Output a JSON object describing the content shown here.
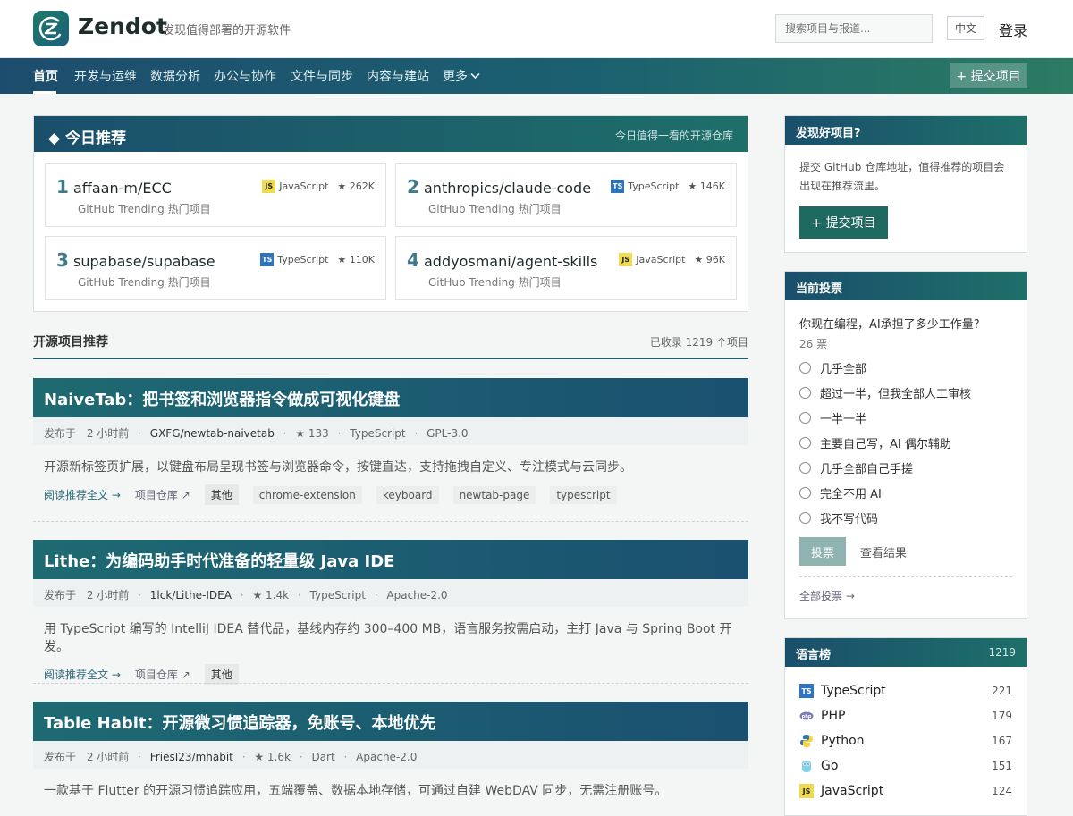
{
  "header": {
    "brand": "Zendot",
    "slogan": "发现值得部署的开源软件",
    "search_placeholder": "搜索项目与报道...",
    "lang_button": "中文",
    "login": "登录"
  },
  "nav": {
    "items": [
      "首页",
      "开发与运维",
      "数据分析",
      "办公与协作",
      "文件与同步",
      "内容与建站",
      "更多"
    ],
    "submit": "+ 提交项目"
  },
  "today": {
    "title": "◆ 今日推荐",
    "subtitle": "今日值得一看的开源仓库",
    "cards": [
      {
        "num": "1",
        "name": "affaan-m/ECC",
        "source": "GitHub Trending 热门项目",
        "lang": "JavaScript",
        "lang_badge": "JS",
        "stars": "★ 262K"
      },
      {
        "num": "2",
        "name": "anthropics/claude-code",
        "source": "GitHub Trending 热门项目",
        "lang": "TypeScript",
        "lang_badge": "TS",
        "stars": "★ 146K"
      },
      {
        "num": "3",
        "name": "supabase/supabase",
        "source": "GitHub Trending 热门项目",
        "lang": "TypeScript",
        "lang_badge": "TS",
        "stars": "★ 110K"
      },
      {
        "num": "4",
        "name": "addyosmani/agent-skills",
        "source": "GitHub Trending 热门项目",
        "lang": "JavaScript",
        "lang_badge": "JS",
        "stars": "★ 96K"
      }
    ]
  },
  "section": {
    "title": "开源项目推荐",
    "count": "已收录 1219 个项目"
  },
  "articles": [
    {
      "title": "NaiveTab：把书签和浏览器指令做成可视化键盘",
      "published_label": "发布于",
      "time": "2 小时前",
      "repo": "GXFG/newtab-naivetab",
      "stars": "★ 133",
      "lang": "TypeScript",
      "license": "GPL-3.0",
      "desc": "开源新标签页扩展，以键盘布局呈现书签与浏览器命令，按键直达，支持拖拽自定义、专注模式与云同步。",
      "read": "阅读推荐全文 →",
      "repo_link": "项目仓库 ↗",
      "tags": [
        "其他",
        "chrome-extension",
        "keyboard",
        "newtab-page",
        "typescript"
      ]
    },
    {
      "title": "Lithe：为编码助手时代准备的轻量级 Java IDE",
      "published_label": "发布于",
      "time": "2 小时前",
      "repo": "1lck/Lithe-IDEA",
      "stars": "★ 1.4k",
      "lang": "TypeScript",
      "license": "Apache-2.0",
      "desc": "用 TypeScript 编写的 IntelliJ IDEA 替代品，基线内存约 300–400 MB，语言服务按需启动，主打 Java 与 Spring Boot 开发。",
      "read": "阅读推荐全文 →",
      "repo_link": "项目仓库 ↗",
      "tags": [
        "其他"
      ]
    },
    {
      "title": "Table Habit：开源微习惯追踪器，免账号、本地优先",
      "published_label": "发布于",
      "time": "2 小时前",
      "repo": "FriesI23/mhabit",
      "stars": "★ 1.6k",
      "lang": "Dart",
      "license": "Apache-2.0",
      "desc": "一款基于 Flutter 的开源习惯追踪应用，五端覆盖、数据本地存储，可通过自建 WebDAV 同步，无需注册账号。"
    }
  ],
  "sidebar": {
    "discover": {
      "title": "发现好项目?",
      "text": "提交 GitHub 仓库地址，值得推荐的项目会出现在推荐流里。",
      "button": "+ 提交项目"
    },
    "poll": {
      "title": "当前投票",
      "question": "你现在编程，AI承担了多少工作量?",
      "votes": "26 票",
      "options": [
        "几乎全部",
        "超过一半，但我全部人工审核",
        "一半一半",
        "主要自己写，AI 偶尔辅助",
        "几乎全部自己手搓",
        "完全不用 AI",
        "我不写代码"
      ],
      "vote_button": "投票",
      "see_results": "查看结果",
      "all_polls": "全部投票 →"
    },
    "languages": {
      "title": "语言榜",
      "total": "1219",
      "items": [
        {
          "name": "TypeScript",
          "count": "221",
          "icon": "typescript-icon"
        },
        {
          "name": "PHP",
          "count": "179",
          "icon": "php-icon"
        },
        {
          "name": "Python",
          "count": "167",
          "icon": "python-icon"
        },
        {
          "name": "Go",
          "count": "151",
          "icon": "go-icon"
        },
        {
          "name": "JavaScript",
          "count": "124",
          "icon": "javascript-icon"
        }
      ]
    }
  },
  "colors": {
    "accent": "#1b5f70",
    "brand_green": "#1f6a60"
  }
}
